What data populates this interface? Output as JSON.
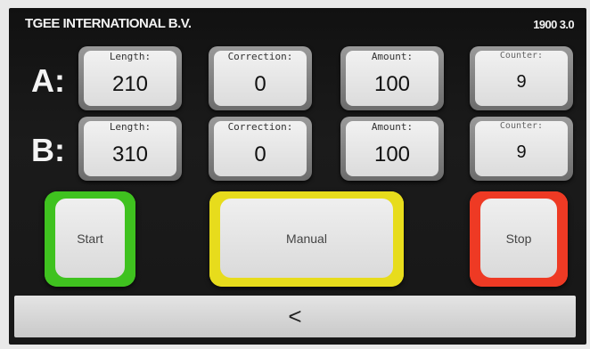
{
  "header": {
    "title": "TGEE INTERNATIONAL B.V.",
    "version": "1900 3.0"
  },
  "rows": [
    {
      "label": "A:",
      "length": {
        "label": "Length:",
        "value": "210"
      },
      "correction": {
        "label": "Correction:",
        "value": "0"
      },
      "amount": {
        "label": "Amount:",
        "value": "100"
      },
      "counter": {
        "label": "Counter:",
        "value": "9"
      }
    },
    {
      "label": "B:",
      "length": {
        "label": "Length:",
        "value": "310"
      },
      "correction": {
        "label": "Correction:",
        "value": "0"
      },
      "amount": {
        "label": "Amount:",
        "value": "100"
      },
      "counter": {
        "label": "Counter:",
        "value": "9"
      }
    }
  ],
  "buttons": {
    "start": {
      "label": "Start",
      "color": "#3fc21f"
    },
    "manual": {
      "label": "Manual",
      "color": "#e7dc1c"
    },
    "stop": {
      "label": "Stop",
      "color": "#ee3a24"
    },
    "back": {
      "label": "<"
    }
  }
}
